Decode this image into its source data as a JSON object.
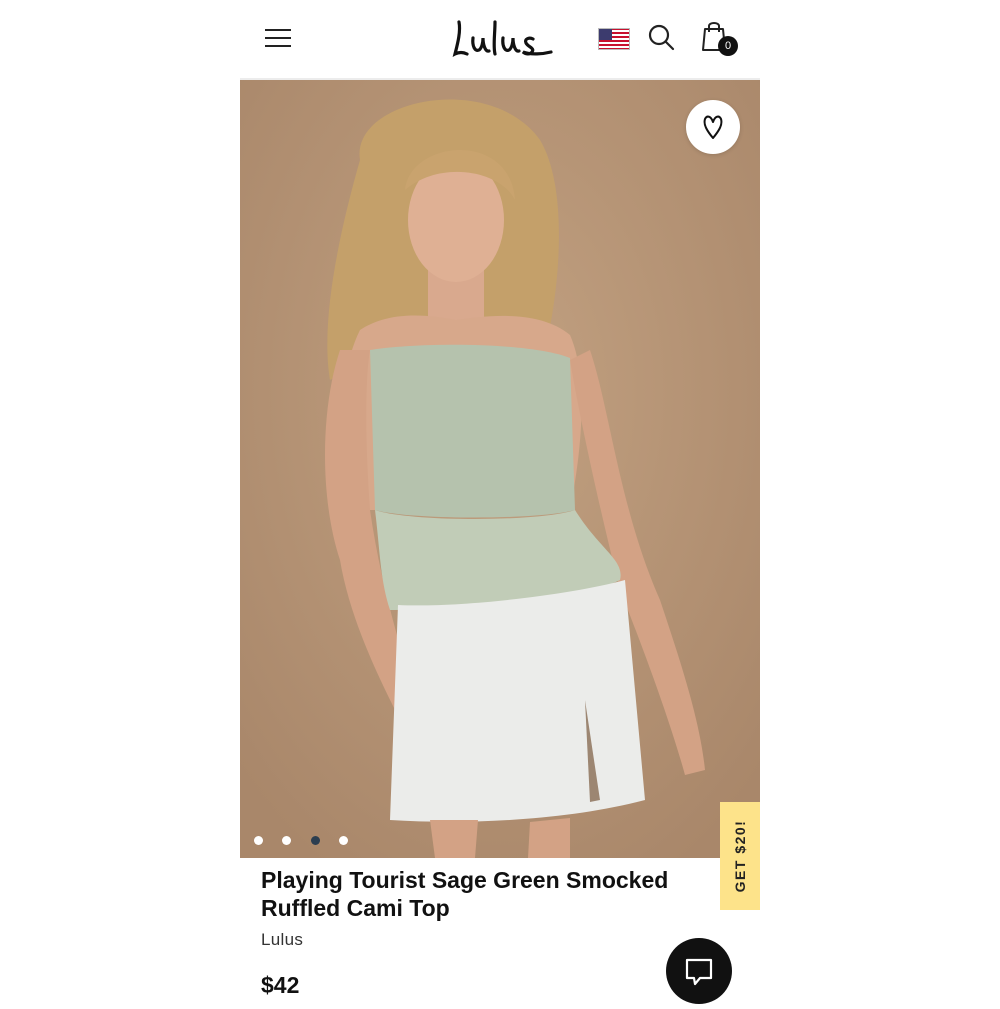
{
  "header": {
    "brand_logo": "Lulus",
    "menu_icon": "hamburger-menu-icon",
    "flag_icon": "us-flag-icon",
    "search_icon": "search-icon",
    "bag_icon": "shopping-bag-icon",
    "bag_count": "0"
  },
  "hero": {
    "wishlist_icon": "heart-icon",
    "image": "product-photo",
    "carousel": {
      "total": 4,
      "active_index": 3
    }
  },
  "promo_tab": {
    "label": "GET $20!",
    "color": "#fde38a"
  },
  "product": {
    "title": "Playing Tourist Sage Green Smocked Ruffled Cami Top",
    "brand": "Lulus",
    "price": "$42"
  },
  "chat": {
    "icon": "chat-bubble-icon"
  },
  "colors": {
    "accent": "#111111",
    "hero_bg": "#b9987a",
    "promo": "#fde38a"
  }
}
